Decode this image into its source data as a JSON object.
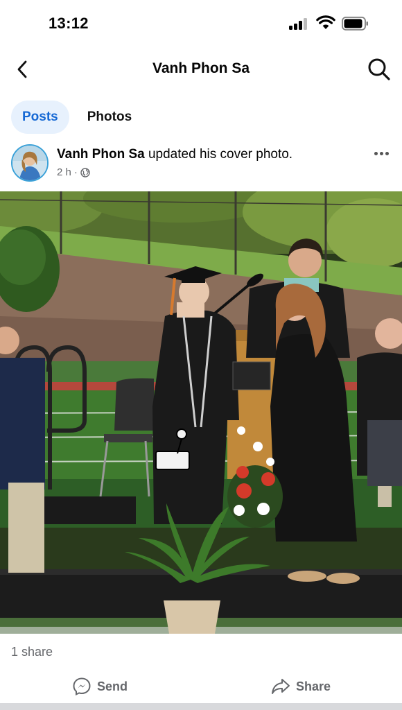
{
  "status_bar": {
    "time": "13:12"
  },
  "header": {
    "title": "Vanh Phon Sa"
  },
  "tabs": [
    {
      "label": "Posts",
      "active": true
    },
    {
      "label": "Photos",
      "active": false
    }
  ],
  "post": {
    "author": "Vanh Phon Sa",
    "action_text": " updated his cover photo.",
    "time_ago": "2 h",
    "separator": "·",
    "audience_icon": "globe-icon"
  },
  "footer": {
    "share_count": "1 share",
    "send_label": "Send",
    "share_label": "Share"
  },
  "colors": {
    "accent": "#1568d4",
    "tab_active_bg": "#e7f1fd",
    "secondary_text": "#65676b"
  }
}
